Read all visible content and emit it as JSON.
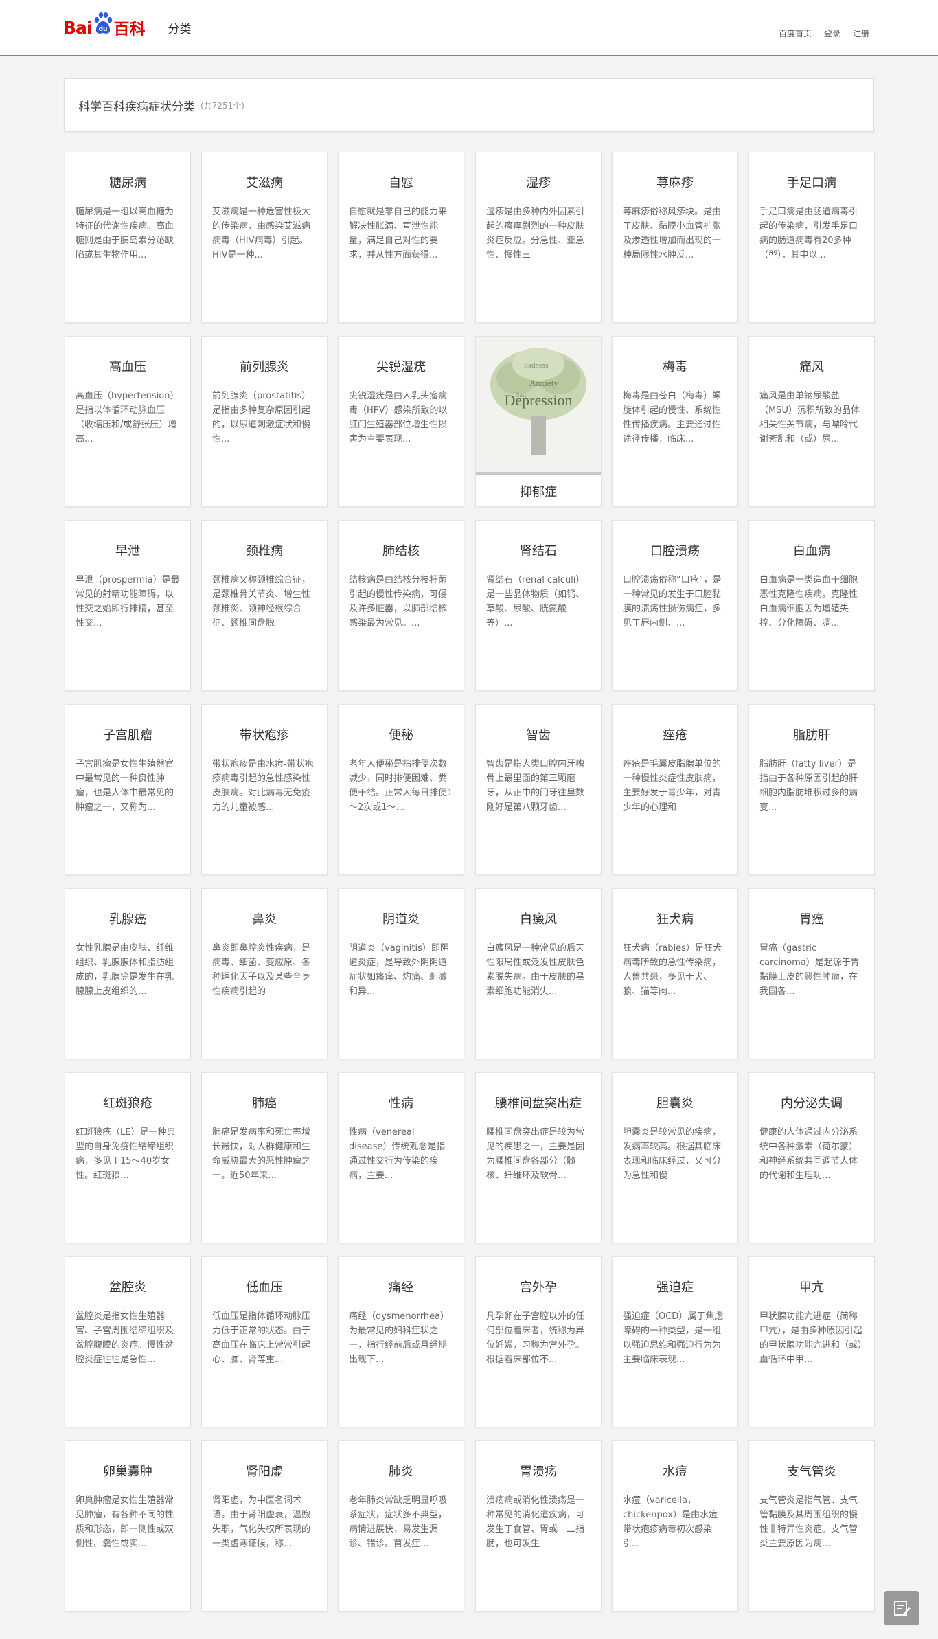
{
  "topbar": {
    "logo_text_bai": "Bai",
    "logo_text_du": "du",
    "logo_text_ke": "百科",
    "section": "分类",
    "links": [
      "百度首页",
      "登录",
      "注册"
    ]
  },
  "header": {
    "title": "科学百科疾病症状分类",
    "count": "(共7251个)"
  },
  "image_card": {
    "word_cloud_main": "Depression",
    "word_cloud_words": [
      "Sadness",
      "Anxiety",
      "Sad"
    ]
  },
  "cards": [
    {
      "title": "糖尿病",
      "desc": "糖尿病是一组以高血糖为特征的代谢性疾病。高血糖则是由于胰岛素分泌缺陷或其生物作用..."
    },
    {
      "title": "艾滋病",
      "desc": "艾滋病是一种危害性极大的传染病，由感染艾滋病病毒（HIV病毒）引起。HIV是一种..."
    },
    {
      "title": "自慰",
      "desc": "自慰就是靠自己的能力来解决性胀满、宣泄性能量，满足自己对性的要求，并从性方面获得..."
    },
    {
      "title": "湿疹",
      "desc": "湿疹是由多种内外因素引起的瘙痒剧烈的一种皮肤炎症反应。分急性、亚急性、慢性三"
    },
    {
      "title": "荨麻疹",
      "desc": "荨麻疹俗称风疹块。是由于皮肤、黏膜小血管扩张及渗透性增加而出现的一种局限性水肿反..."
    },
    {
      "title": "手足口病",
      "desc": "手足口病是由肠道病毒引起的传染病，引发手足口病的肠道病毒有20多种（型），其中以..."
    },
    {
      "title": "高血压",
      "desc": "高血压（hypertension）是指以体循环动脉血压（收缩压和/或舒张压）增高..."
    },
    {
      "title": "前列腺炎",
      "desc": "前列腺炎（prostatitis）是指由多种复杂原因引起的，以尿道刺激症状和慢性..."
    },
    {
      "title": "尖锐湿疣",
      "desc": "尖锐湿疣是由人乳头瘤病毒（HPV）感染所致的以肛门生殖器部位增生性损害为主要表现..."
    },
    {
      "title": "抑郁症",
      "desc": ""
    },
    {
      "title": "梅毒",
      "desc": "梅毒是由苍白（梅毒）螺旋体引起的慢性、系统性性传播疾病。主要通过性途径传播，临床..."
    },
    {
      "title": "痛风",
      "desc": "痛风是由单钠尿酸盐（MSU）沉积所致的晶体相关性关节病，与嘌呤代谢紊乱和（或）尿..."
    },
    {
      "title": "早泄",
      "desc": "早泄（prospermia）是最常见的射精功能障碍，以性交之始即行排精，甚至性交..."
    },
    {
      "title": "颈椎病",
      "desc": "颈椎病又称颈椎综合征，是颈椎骨关节炎、增生性颈椎炎、颈神经根综合征、颈椎间盘脱"
    },
    {
      "title": "肺结核",
      "desc": "结核病是由结核分枝杆菌引起的慢性传染病，可侵及许多脏器，以肺部结核感染最为常见。..."
    },
    {
      "title": "肾结石",
      "desc": "肾结石（renal calculi）是一些晶体物质（如钙、草酸、尿酸、胱氨酸等）..."
    },
    {
      "title": "口腔溃疡",
      "desc": "口腔溃疡俗称“口疮”，是一种常见的发生于口腔黏膜的溃疡性损伤病症，多见于唇内侧、..."
    },
    {
      "title": "白血病",
      "desc": "白血病是一类造血干细胞恶性克隆性疾病。克隆性白血病细胞因为增殖失控、分化障碍、凋..."
    },
    {
      "title": "子宫肌瘤",
      "desc": "子宫肌瘤是女性生殖器官中最常见的一种良性肿瘤，也是人体中最常见的肿瘤之一，又称为..."
    },
    {
      "title": "带状疱疹",
      "desc": "带状疱疹是由水痘-带状疱疹病毒引起的急性感染性皮肤病。对此病毒无免疫力的儿童被感..."
    },
    {
      "title": "便秘",
      "desc": "老年人便秘是指排便次数减少，同时排便困难、粪便干结。正常人每日排便1～2次或1～..."
    },
    {
      "title": "智齿",
      "desc": "智齿是指人类口腔内牙槽骨上最里面的第三颗磨牙，从正中的门牙往里数刚好是第八颗牙齿..."
    },
    {
      "title": "痤疮",
      "desc": "痤疮是毛囊皮脂腺单位的一种慢性炎症性皮肤病，主要好发于青少年，对青少年的心理和"
    },
    {
      "title": "脂肪肝",
      "desc": "脂肪肝（fatty liver）是指由于各种原因引起的肝细胞内脂肪堆积过多的病变..."
    },
    {
      "title": "乳腺癌",
      "desc": "女性乳腺是由皮肤、纤维组织、乳腺腺体和脂肪组成的，乳腺癌是发生在乳腺腺上皮组织的..."
    },
    {
      "title": "鼻炎",
      "desc": "鼻炎即鼻腔炎性疾病，是病毒、细菌、变应原、各种理化因子以及某些全身性疾病引起的"
    },
    {
      "title": "阴道炎",
      "desc": "阴道炎（vaginitis）即阴道炎症，是导致外阴阴道症状如瘙痒、灼痛、刺激和异..."
    },
    {
      "title": "白癜风",
      "desc": "白癜风是一种常见的后天性限局性或泛发性皮肤色素脱失病。由于皮肤的黑素细胞功能消失..."
    },
    {
      "title": "狂犬病",
      "desc": "狂犬病（rabies）是狂犬病毒所致的急性传染病，人兽共患，多见于犬、狼、猫等肉..."
    },
    {
      "title": "胃癌",
      "desc": "胃癌（gastric carcinoma）是起源于胃黏膜上皮的恶性肿瘤，在我国各..."
    },
    {
      "title": "红斑狼疮",
      "desc": "红斑狼疮（LE）是一种典型的自身免疫性结缔组织病，多见于15～40岁女性。红斑狼..."
    },
    {
      "title": "肺癌",
      "desc": "肺癌是发病率和死亡率增长最快，对人群健康和生命威胁最大的恶性肿瘤之一。近50年来..."
    },
    {
      "title": "性病",
      "desc": "性病（venereal disease）传统观念是指通过性交行为传染的疾病，主要..."
    },
    {
      "title": "腰椎间盘突出症",
      "desc": "腰椎间盘突出症是较为常见的疾患之一，主要是因为腰椎间盘各部分（髓核、纤维环及软骨..."
    },
    {
      "title": "胆囊炎",
      "desc": "胆囊炎是较常见的疾病，发病率较高。根据其临床表现和临床经过，又可分为急性和慢"
    },
    {
      "title": "内分泌失调",
      "desc": "健康的人体通过内分泌系统中各种激素（荷尔蒙）和神经系统共同调节人体的代谢和生理功..."
    },
    {
      "title": "盆腔炎",
      "desc": "盆腔炎是指女性生殖器官、子宫周围结缔组织及盆腔腹膜的炎症。慢性盆腔炎症往往是急性..."
    },
    {
      "title": "低血压",
      "desc": "低血压是指体循环动脉压力低于正常的状态。由于高血压在临床上常常引起心、脑、肾等重..."
    },
    {
      "title": "痛经",
      "desc": "痛经（dysmenorrhea）为最常见的妇科症状之一，指行经前后或月经期出现下..."
    },
    {
      "title": "宫外孕",
      "desc": "凡孕卵在子宫腔以外的任何部位着床者，统称为异位妊娠，习称为宫外孕。根据着床部位不..."
    },
    {
      "title": "强迫症",
      "desc": "强迫症（OCD）属于焦虑障碍的一种类型，是一组以强迫思维和强迫行为为主要临床表现..."
    },
    {
      "title": "甲亢",
      "desc": "甲状腺功能亢进症（简称甲亢），是由多种原因引起的甲状腺功能亢进和（或）血循环中甲..."
    },
    {
      "title": "卵巢囊肿",
      "desc": "卵巢肿瘤是女性生殖器常见肿瘤，有各种不同的性质和形态，即一侧性或双侧性、囊性或实..."
    },
    {
      "title": "肾阳虚",
      "desc": "肾阳虚，为中医名词术语。由于肾阳虚衰，温煦失职，气化失权所表现的一类虚寒证候，称..."
    },
    {
      "title": "肺炎",
      "desc": "老年肺炎常缺乏明显呼吸系症状，症状多不典型，病情进展快，易发生漏诊、错诊。首发症..."
    },
    {
      "title": "胃溃疡",
      "desc": "溃疡病或消化性溃疡是一种常见的消化道疾病，可发生于食管、胃或十二指肠，也可发生"
    },
    {
      "title": "水痘",
      "desc": "水痘（varicella，chickenpox）是由水痘-带状疱疹病毒初次感染引..."
    },
    {
      "title": "支气管炎",
      "desc": "支气管炎是指气管、支气管黏膜及其周围组织的慢性非特异性炎症。支气管炎主要原因为病..."
    }
  ],
  "colors": {
    "brand_red": "#e10602",
    "brand_blue": "#2d5bd6",
    "accent_line": "#4c8fd8"
  }
}
